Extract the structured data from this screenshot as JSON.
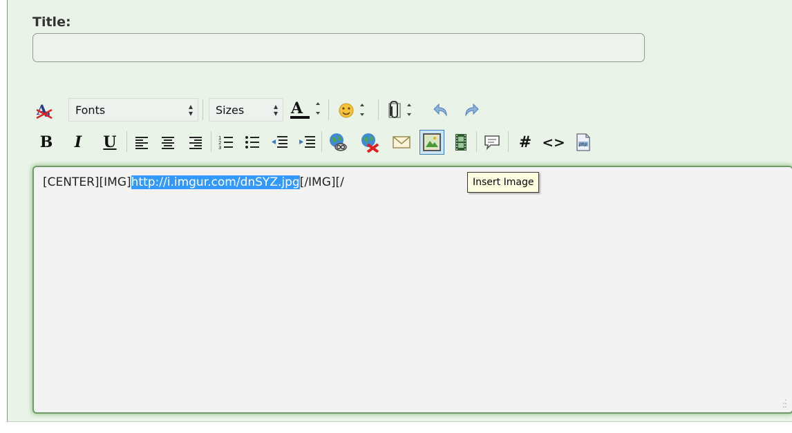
{
  "form": {
    "title_label": "Title:",
    "title_value": ""
  },
  "toolbar1": {
    "fonts_label": "Fonts",
    "sizes_label": "Sizes",
    "items": [
      "remove-format-icon",
      "font-color-icon",
      "smilies-icon",
      "attachment-icon",
      "undo-icon",
      "redo-icon"
    ]
  },
  "toolbar2": {
    "bold": "B",
    "italic": "I",
    "underline": "U",
    "hash": "#",
    "code": "<>",
    "items": [
      "align-left-icon",
      "align-center-icon",
      "align-right-icon",
      "ordered-list-icon",
      "unordered-list-icon",
      "outdent-icon",
      "indent-icon",
      "insert-link-icon",
      "remove-link-icon",
      "insert-email-icon",
      "insert-image-icon",
      "insert-video-icon",
      "quote-icon",
      "wrap-hash-icon",
      "wrap-code-icon",
      "wrap-php-icon"
    ]
  },
  "editor": {
    "text_before": "[CENTER][IMG]",
    "text_selected": "http://i.imgur.com/dnSYZ.jpg",
    "text_after": "[/IMG][/"
  },
  "tooltip": {
    "text": "Insert Image"
  },
  "colors": {
    "accent": "#3399ff",
    "panel_bg": "#eaf3e8",
    "editor_border": "#6f9a68"
  }
}
